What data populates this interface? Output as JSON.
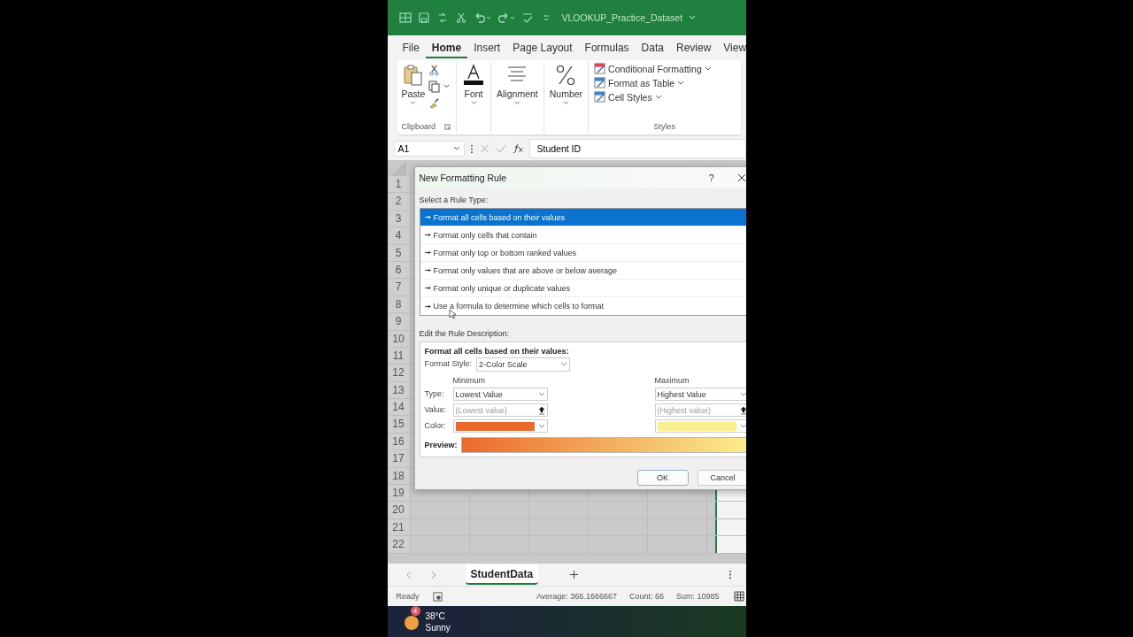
{
  "title_bar": {
    "file_name": "VLOOKUP_Practice_Dataset"
  },
  "ribbon_tabs": [
    {
      "label": "File",
      "selected": false
    },
    {
      "label": "Home",
      "selected": true
    },
    {
      "label": "Insert",
      "selected": false
    },
    {
      "label": "Page Layout",
      "selected": false
    },
    {
      "label": "Formulas",
      "selected": false
    },
    {
      "label": "Data",
      "selected": false
    },
    {
      "label": "Review",
      "selected": false
    },
    {
      "label": "View",
      "selected": false
    }
  ],
  "ribbon": {
    "paste": "Paste",
    "clipboard_label": "Clipboard",
    "font": "Font",
    "alignment": "Alignment",
    "number": "Number",
    "styles": [
      "Conditional Formatting",
      "Format as Table",
      "Cell Styles"
    ],
    "styles_label": "Styles"
  },
  "formula_bar": {
    "name_box": "A1",
    "value": "Student ID"
  },
  "grid": {
    "row_headers": [
      "1",
      "2",
      "3",
      "4",
      "5",
      "6",
      "7",
      "8",
      "9",
      "10",
      "11",
      "12",
      "13",
      "14",
      "15",
      "16",
      "17",
      "18",
      "19",
      "20",
      "21",
      "22"
    ]
  },
  "dialog": {
    "title": "New Formatting Rule",
    "help": "?",
    "rule_type_label": "Select a Rule Type:",
    "rule_types": [
      {
        "label": "Format all cells based on their values",
        "selected": true
      },
      {
        "label": "Format only cells that contain",
        "selected": false
      },
      {
        "label": "Format only top or bottom ranked values",
        "selected": false
      },
      {
        "label": "Format only values that are above or below average",
        "selected": false
      },
      {
        "label": "Format only unique or duplicate values",
        "selected": false
      },
      {
        "label": "Use a formula to determine which cells to format",
        "selected": false
      }
    ],
    "description_label": "Edit the Rule Description:",
    "description_title": "Format all cells based on their values:",
    "format_style_label": "Format Style:",
    "format_style": "2-Color Scale",
    "type_label": "Type:",
    "value_label": "Value:",
    "color_label": "Color:",
    "preview_label": "Preview:",
    "minimum": {
      "heading": "Minimum",
      "type": "Lowest Value",
      "value_placeholder": "(Lowest value)",
      "color": "#ea6a2c"
    },
    "maximum": {
      "heading": "Maximum",
      "type": "Highest Value",
      "value_placeholder": "(Highest value)",
      "color": "#fbee8e"
    },
    "buttons": [
      "OK",
      "Cancel"
    ]
  },
  "sheet_tabs": [
    {
      "label": "StudentData",
      "selected": true
    }
  ],
  "status_bar": {
    "ready": "Ready",
    "stats": [
      "Average: 366.1666667",
      "Count: 66",
      "Sum: 10985"
    ]
  },
  "taskbar": {
    "badge": "4",
    "temperature": "38°C",
    "condition": "Sunny"
  }
}
